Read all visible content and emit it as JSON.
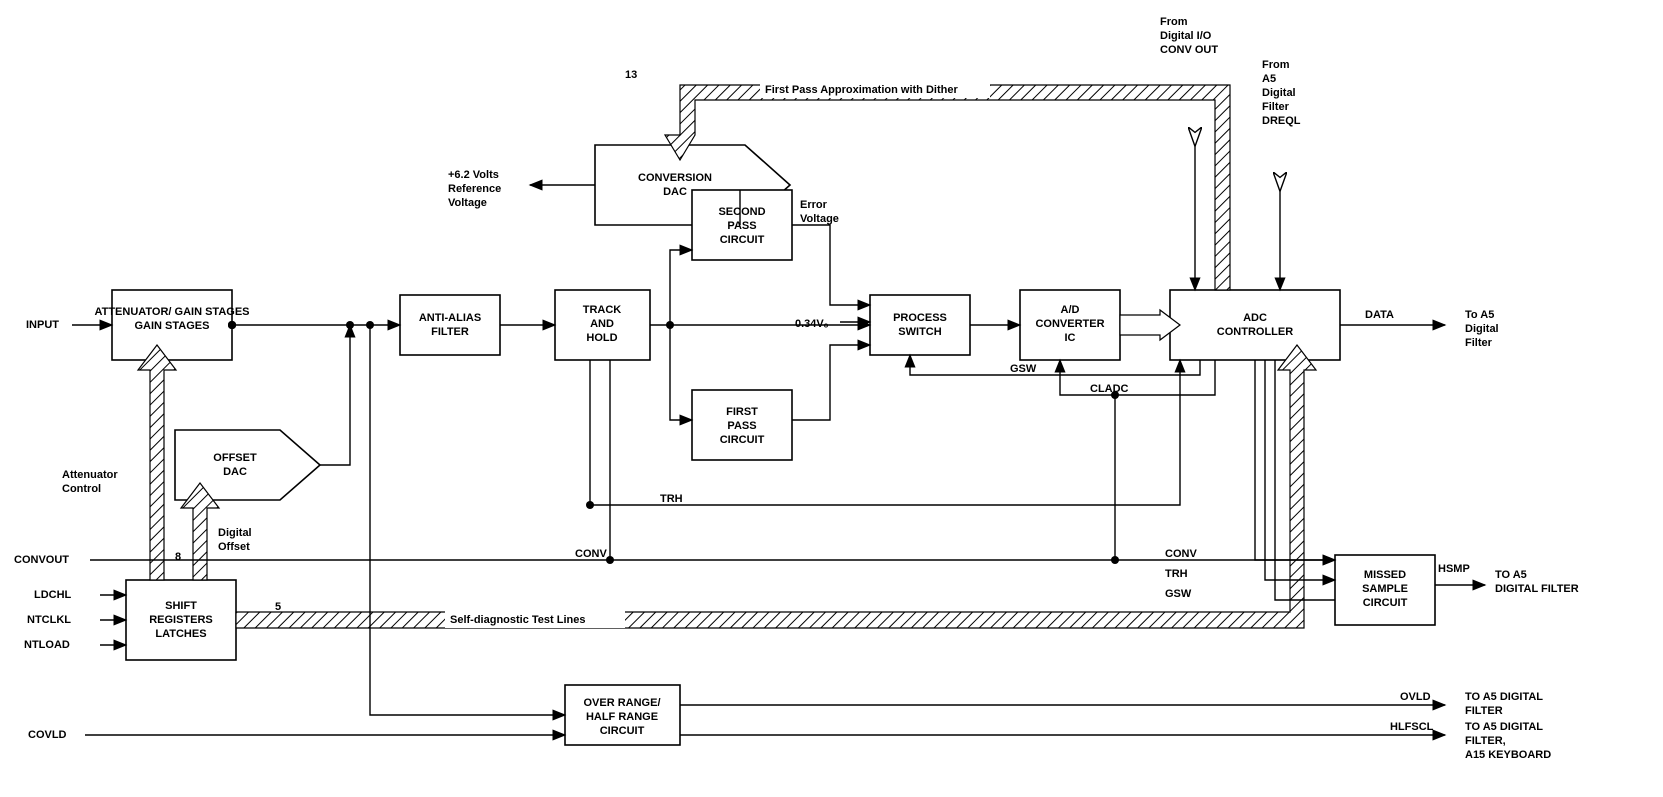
{
  "inputs": {
    "input": "INPUT",
    "convout": "CONVOUT",
    "ldchl": "LDCHL",
    "ntclkl": "NTCLKL",
    "ntload": "NTLOAD",
    "covld": "COVLD"
  },
  "blocks": {
    "atten": "ATTENUATOR/\nGAIN STAGES",
    "offset_dac": "OFFSET\nDAC",
    "shift_reg": "SHIFT\nREGISTERS\nLATCHES",
    "anti_alias": "ANTI-ALIAS\nFILTER",
    "track_hold": "TRACK\nAND\nHOLD",
    "conv_dac": "CONVERSION\nDAC",
    "second_pass": "SECOND\nPASS\nCIRCUIT",
    "first_pass": "FIRST\nPASS\nCIRCUIT",
    "process_switch": "PROCESS\nSWITCH",
    "adc_ic": "A/D\nCONVERTER\nIC",
    "adc_ctrl": "ADC\nCONTROLLER",
    "missed_sample": "MISSED\nSAMPLE\nCIRCUIT",
    "over_range": "OVER RANGE/\nHALF RANGE\nCIRCUIT"
  },
  "labels": {
    "ref_voltage": "+6.2 Volts\nReference\nVoltage",
    "error_voltage": "Error\nVoltage",
    "v034": "0.34Vₒ",
    "first_pass_dither": "First Pass Approximation with Dither",
    "thirteen": "13",
    "atten_ctrl": "Attenuator\nControl",
    "digital_offset": "Digital\nOffset",
    "eight": "8",
    "five": "5",
    "self_diag": "Self-diagnostic Test Lines",
    "trh": "TRH",
    "conv": "CONV",
    "gsw": "GSW",
    "cladc": "CLADC",
    "from_dio": "From\nDigital I/O\nCONV OUT",
    "from_a5": "From\nA5\nDigital\nFilter\nDREQL"
  },
  "outputs": {
    "data": "DATA",
    "data_dest": "To A5\nDigital\nFilter",
    "hsmp": "HSMP",
    "hsmp_dest": "TO A5\nDIGITAL FILTER",
    "ovld": "OVLD",
    "ovld_dest": "TO A5 DIGITAL\nFILTER",
    "hlfscl": "HLFSCL",
    "hlfscl_dest": "TO A5 DIGITAL\nFILTER,\nA15 KEYBOARD"
  }
}
